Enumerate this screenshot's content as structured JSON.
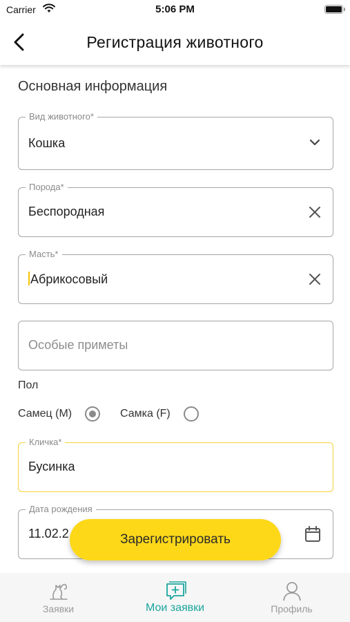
{
  "status_bar": {
    "carrier": "Carrier",
    "time": "5:06 PM"
  },
  "header": {
    "title": "Регистрация животного",
    "back_icon": "chevron-left-icon"
  },
  "section_title": "Основная информация",
  "fields": {
    "species": {
      "label": "Вид животного*",
      "value": "Кошка",
      "icon": "chevron-down-icon"
    },
    "breed": {
      "label": "Порода*",
      "value": "Беспородная",
      "icon": "close-icon"
    },
    "color": {
      "label": "Масть*",
      "value": "Абрикосовый",
      "icon": "close-icon"
    },
    "features": {
      "placeholder": "Особые приметы"
    },
    "nickname": {
      "label": "Кличка*",
      "value": "Бусинка"
    },
    "birth_date": {
      "label": "Дата рождения",
      "value": "11.02.2",
      "icon": "calendar-icon"
    }
  },
  "gender": {
    "label": "Пол",
    "options": [
      {
        "label": "Самец (M)",
        "selected": true
      },
      {
        "label": "Самка (F)",
        "selected": false
      }
    ]
  },
  "register_button": "Зарегистрировать",
  "tabs": [
    {
      "label": "Заявки",
      "icon": "pets-icon",
      "active": false
    },
    {
      "label": "Мои заявки",
      "icon": "add-request-icon",
      "active": true
    },
    {
      "label": "Профиль",
      "icon": "profile-icon",
      "active": false
    }
  ],
  "colors": {
    "accent_yellow": "#fdd819",
    "active_tab": "#1aa59e",
    "focus_border": "#f2d23a"
  }
}
